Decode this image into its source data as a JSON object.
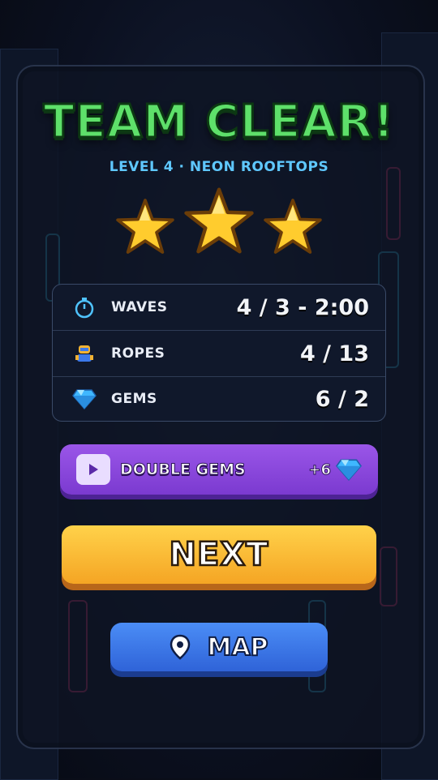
{
  "title": "TEAM CLEAR!",
  "subtitle": "LEVEL 4 · NEON ROOFTOPS",
  "stars_earned": 3,
  "stars_total": 3,
  "stats": [
    {
      "icon": "stopwatch-icon",
      "label": "WAVES",
      "value": "4 / 3 - 2:00"
    },
    {
      "icon": "robot-icon",
      "label": "ROPES",
      "value": "4 / 13"
    },
    {
      "icon": "gem-icon",
      "label": "GEMS",
      "value": "6 / 2"
    }
  ],
  "double_gems": {
    "label": "DOUBLE GEMS",
    "reward": "+6",
    "icon": "play-icon"
  },
  "next_label": "NEXT",
  "map_label": "MAP",
  "colors": {
    "title_green": "#5ee06a",
    "subtitle_blue": "#5fc8ff",
    "star_gold": "#ffcc2e",
    "purple_button": "#8a48dc",
    "orange_button": "#f8b633",
    "blue_button": "#3b78ea"
  }
}
